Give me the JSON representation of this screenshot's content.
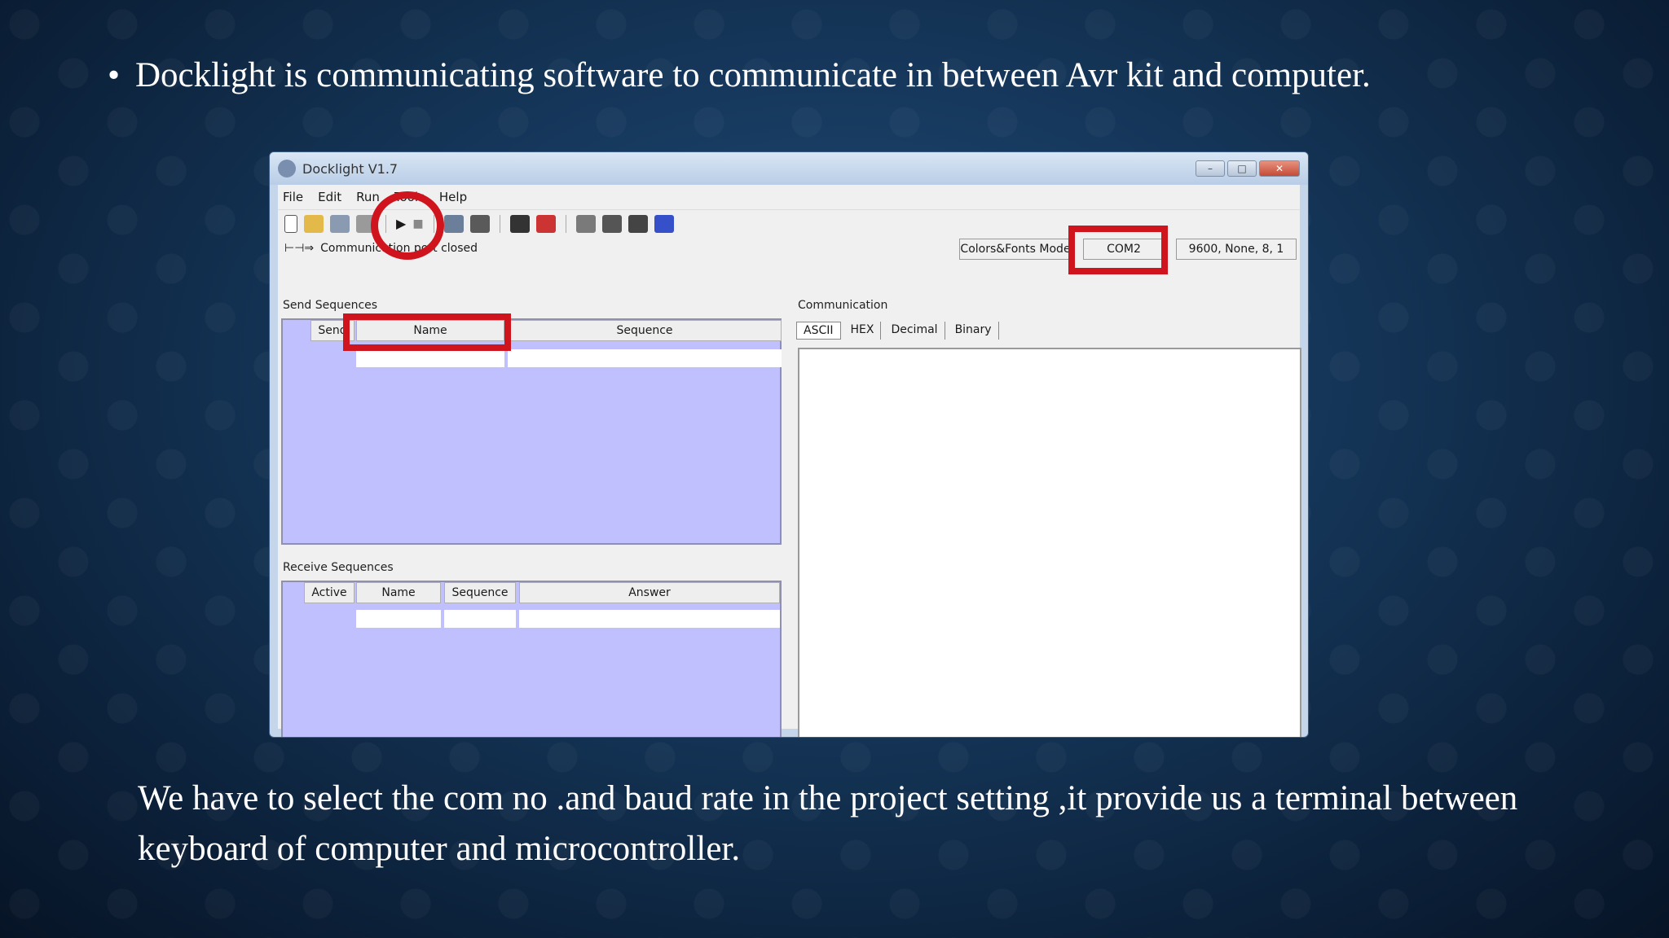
{
  "slide": {
    "bullet_text": "Docklight is communicating software to communicate in between Avr kit and computer.",
    "bottom_text": "We have to select the com no .and baud rate in the project setting ,it provide us a terminal between keyboard of computer and microcontroller."
  },
  "window": {
    "title": "Docklight V1.7",
    "menu": [
      "File",
      "Edit",
      "Run",
      "Tools",
      "Help"
    ],
    "status": {
      "communication": "Communication port closed",
      "mode": "Colors&Fonts Mode",
      "port": "COM2",
      "settings": "9600, None, 8, 1"
    },
    "send_sequences": {
      "label": "Send Sequences",
      "columns": [
        "Send",
        "Name",
        "Sequence"
      ]
    },
    "receive_sequences": {
      "label": "Receive Sequences",
      "columns": [
        "Active",
        "Name",
        "Sequence",
        "Answer"
      ]
    },
    "communication": {
      "label": "Communication",
      "tabs": [
        "ASCII",
        "HEX",
        "Decimal",
        "Binary"
      ],
      "active_tab": "ASCII"
    }
  },
  "colors": {
    "highlight": "#d0141e",
    "grid_bg": "#c0c0ff"
  },
  "icons": [
    "new-file-icon",
    "open-folder-icon",
    "save-icon",
    "print-icon",
    "play-icon",
    "stop-icon",
    "project-settings-icon",
    "find-icon",
    "binoculars-icon",
    "clear-icon",
    "tools-icon",
    "gear-icon",
    "keyboard-icon",
    "exit-icon"
  ]
}
